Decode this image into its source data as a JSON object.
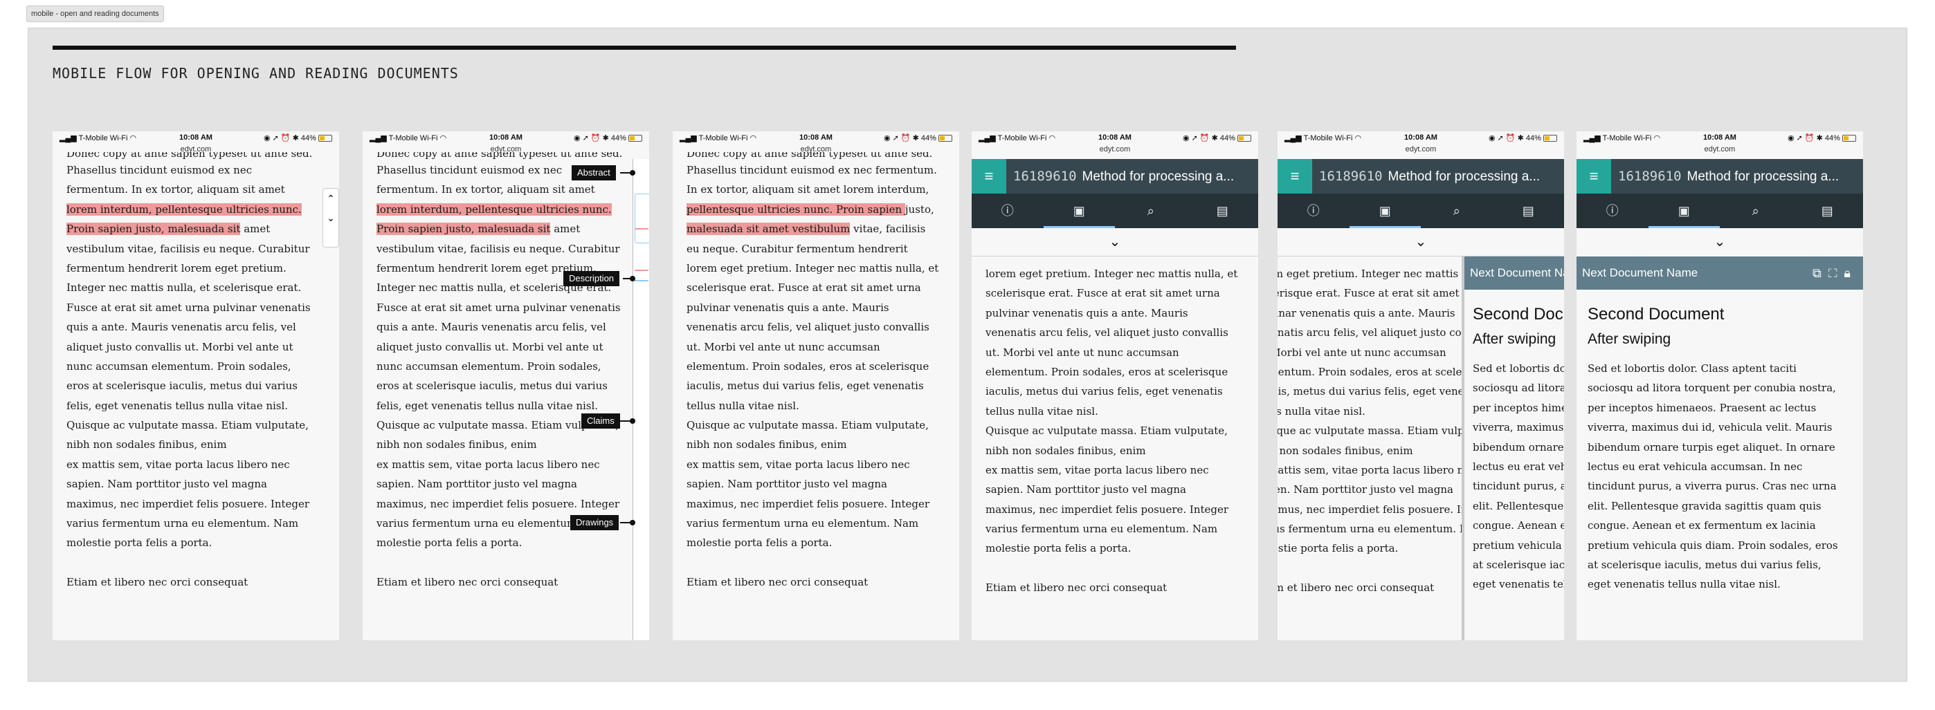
{
  "tab_label": "mobile - open and reading documents",
  "page_title": "MOBILE FLOW FOR OPENING AND READING DOCUMENTS",
  "status": {
    "carrier": "T-Mobile Wi-Fi",
    "time": "10:08 AM",
    "url": "edyt.com",
    "battery": "44%"
  },
  "doc": {
    "partial_top": "Donec copy at ante sapien typeset ut ante sed.",
    "lines": [
      "Phasellus tincidunt euismod ex nec fermentum.",
      "In ex tortor, aliquam sit amet lorem interdum,",
      "pellentesque ultricies nunc. Proin sapien justo,",
      "malesuada sit amet vestibulum vitae, facilisis",
      "eu neque. Curabitur fermentum hendrerit",
      "lorem eget pretium. Integer nec mattis nulla, et",
      "scelerisque erat. Fusce at erat sit amet urna",
      "pulvinar venenatis quis a ante. Mauris",
      "venenatis arcu felis, vel aliquet justo convallis",
      "ut. Morbi vel ante ut nunc accumsan",
      "elementum. Proin sodales, eros at scelerisque",
      "iaculis, metus dui varius felis, eget venenatis",
      "tellus nulla vitae nisl.",
      "Quisque ac vulputate massa. Etiam vulputate,",
      "nibh non sodales finibus, enim",
      "ex mattis sem, vitae porta lacus libero nec",
      "sapien. Nam porttitor justo vel magna",
      "maximus, nec imperdiet felis posuere. Integer",
      "varius fermentum urna eu elementum. Nam",
      "molestie porta felis a porta."
    ],
    "narrow_lines": [
      "Phasellus tincidunt euismod ex nec",
      "fermentum. In ex tortor, aliquam sit amet",
      "lorem interdum, pellentesque ultricies nunc.",
      "Proin sapien justo, malesuada sit amet",
      "vestibulum vitae, facilisis eu neque. Curabitur",
      "fermentum hendrerit lorem eget pretium.",
      "Integer nec mattis nulla, et scelerisque erat.",
      "Fusce at erat sit amet urna pulvinar venenatis",
      "quis a ante. Mauris venenatis arcu felis, vel",
      "aliquet justo convallis ut. Morbi vel ante ut",
      "nunc accumsan elementum. Proin sodales,",
      "eros at scelerisque iaculis, metus dui varius",
      "felis, eget venenatis tellus nulla vitae nisl.",
      "Quisque ac vulputate massa. Etiam vulputate,",
      "nibh non sodales finibus, enim",
      "ex mattis sem, vitae porta lacus libero nec",
      "sapien. Nam porttitor justo vel magna",
      "maximus, nec imperdiet felis posuere. Integer",
      "varius fermentum urna eu elementum. Nam",
      "molestie porta felis a porta."
    ],
    "last_line": "Etiam et libero nec orci consequat"
  },
  "callouts": [
    "Abstract",
    "Description",
    "Claims",
    "Drawings"
  ],
  "app": {
    "doc_number": "16189610",
    "doc_title": "Method for processing a...",
    "menu_icon": "hamburger-menu-icon",
    "tabs": [
      "info-icon",
      "inbox-icon",
      "search-icon",
      "document-icon"
    ]
  },
  "next_doc": {
    "header": "Next Document Name",
    "heading": "Second Document",
    "subheading": "After swiping",
    "paragraph": [
      "Sed et lobortis dolor. Class aptent taciti",
      "sociosqu ad litora torquent per conubia nostra,",
      "per inceptos himenaeos. Praesent ac lectus",
      "viverra, maximus dui id, vehicula velit. Mauris",
      "bibendum ornare turpis eget aliquet. In ornare",
      "lectus eu erat vehicula accumsan. In nec",
      "tincidunt purus, a viverra purus. Cras nec urna",
      "elit. Pellentesque gravida sagittis quam quis",
      "congue. Aenean et ex fermentum ex lacinia",
      "pretium vehicula quis diam. Proin sodales, eros",
      "at scelerisque iaculis, metus dui varius felis,",
      "eget venenatis tellus nulla vitae nisl."
    ]
  },
  "colors": {
    "highlight": "#ee9a9a",
    "appbar": "#37474f",
    "tabbar": "#263238",
    "menu_button": "#26a69a",
    "next_header": "#607d8b"
  }
}
